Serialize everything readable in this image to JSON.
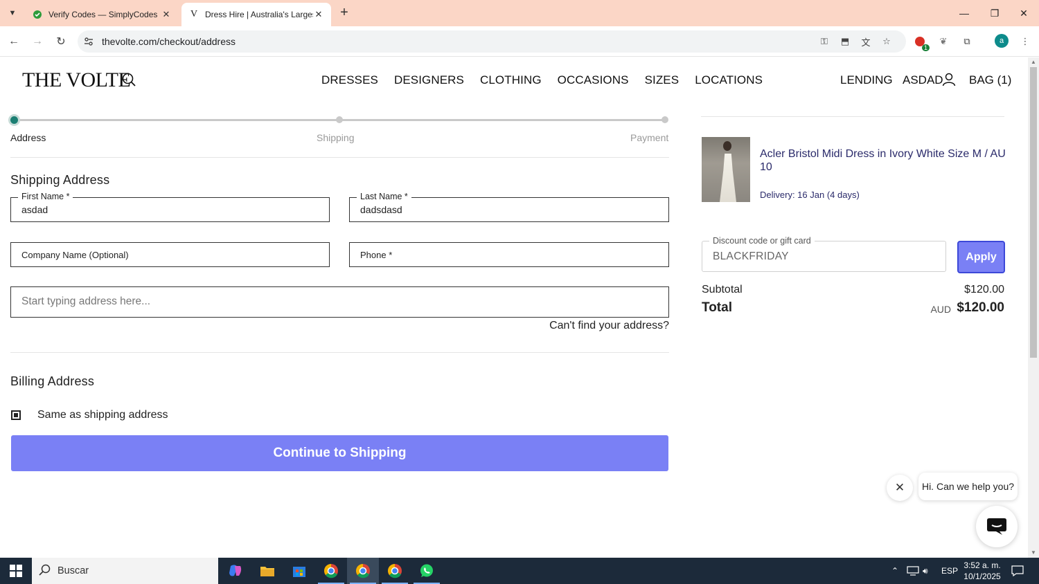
{
  "browser": {
    "tabs": [
      {
        "title": "Verify Codes — SimplyCodes",
        "active": false
      },
      {
        "title": "Dress Hire | Australia's Largest D",
        "active": true
      }
    ],
    "url": "thevolte.com/checkout/address",
    "extension_badge": "1",
    "profile_initial": "a"
  },
  "site": {
    "logo": "THE VOLTE",
    "main_nav": [
      "DRESSES",
      "DESIGNERS",
      "CLOTHING",
      "OCCASIONS",
      "SIZES",
      "LOCATIONS"
    ],
    "lending": "LENDING",
    "account": "ASDAD",
    "bag": "BAG (1)"
  },
  "checkout": {
    "steps": [
      "Address",
      "Shipping",
      "Payment"
    ],
    "active_step": "Address",
    "shipping_title": "Shipping Address",
    "first_name_label": "First Name *",
    "first_name_value": "asdad",
    "last_name_label": "Last Name *",
    "last_name_value": "dadsdasd",
    "company_placeholder": "Company Name (Optional)",
    "phone_placeholder": "Phone *",
    "address_placeholder": "Start typing address here...",
    "cant_find": "Can't find your address?",
    "billing_title": "Billing Address",
    "same_as_shipping": "Same as shipping address",
    "same_as_shipping_checked": true,
    "continue_label": "Continue to Shipping"
  },
  "summary": {
    "product_title": "Acler Bristol Midi Dress in Ivory White Size M / AU 10",
    "delivery": "Delivery: 16 Jan (4 days)",
    "discount_label": "Discount code or gift card",
    "discount_value": "BLACKFRIDAY",
    "apply_label": "Apply",
    "subtotal_label": "Subtotal",
    "subtotal_value": "$120.00",
    "total_label": "Total",
    "total_currency": "AUD",
    "total_value": "$120.00"
  },
  "chat": {
    "greeting": "Hi. Can we help you?"
  },
  "taskbar": {
    "search_placeholder": "Buscar",
    "language": "ESP",
    "time": "3:52 a. m.",
    "date": "10/1/2025"
  },
  "colors": {
    "tabbar": "#fbd6c6",
    "accent_button": "#7a80f5",
    "step_active": "#1b7f73",
    "taskbar": "#1c2a3a"
  }
}
